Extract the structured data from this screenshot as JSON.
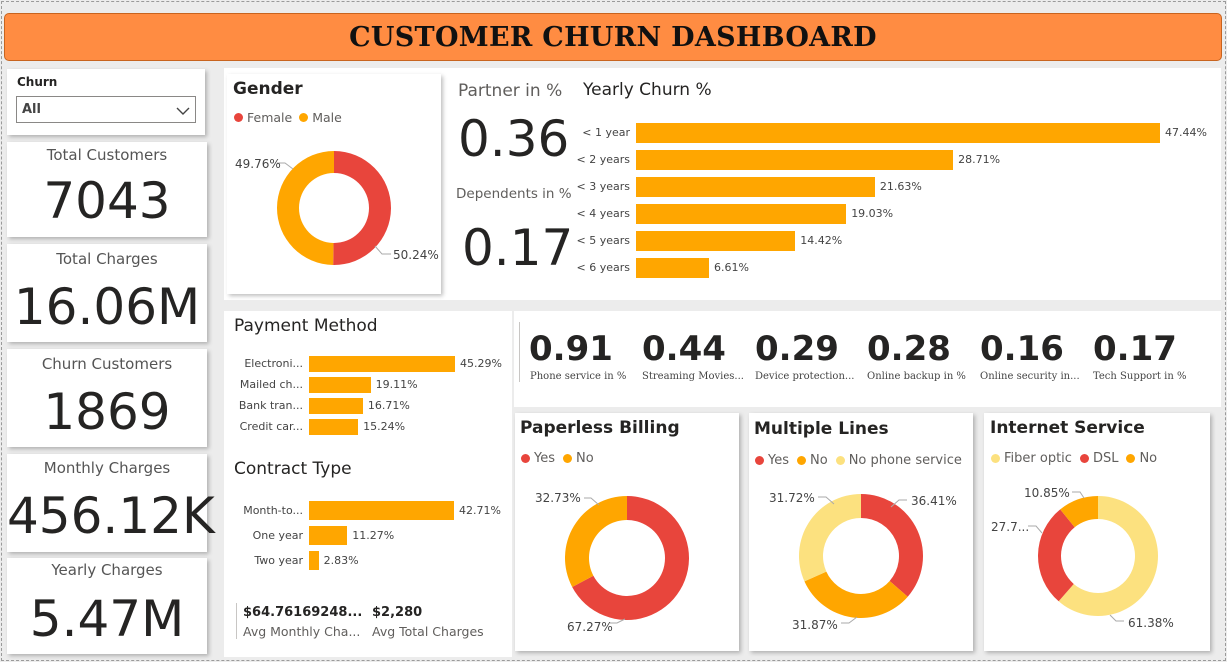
{
  "title": "CUSTOMER CHURN DASHBOARD",
  "slicer": {
    "label": "Churn",
    "value": "All"
  },
  "kpis": {
    "total_customers": {
      "label": "Total Customers",
      "value": "7043"
    },
    "total_charges": {
      "label": "Total Charges",
      "value": "16.06M"
    },
    "churn_customers": {
      "label": "Churn Customers",
      "value": "1869"
    },
    "monthly_charges": {
      "label": "Monthly Charges",
      "value": "456.12K"
    },
    "yearly_charges": {
      "label": "Yearly Charges",
      "value": "5.47M"
    }
  },
  "gender": {
    "title": "Gender",
    "legend": [
      "Female",
      "Male"
    ],
    "labels": {
      "male": "49.76%",
      "female": "50.24%"
    }
  },
  "partner": {
    "label": "Partner in %",
    "value": "0.36"
  },
  "dependents": {
    "label": "Dependents in %",
    "value": "0.17"
  },
  "yearly_churn": {
    "title": "Yearly Churn %"
  },
  "payment": {
    "title": "Payment Method"
  },
  "contract": {
    "title": "Contract Type"
  },
  "avg": {
    "monthly": {
      "value": "$64.76169248...",
      "label": "Avg Monthly Cha..."
    },
    "total": {
      "value": "$2,280",
      "label": "Avg Total Charges"
    }
  },
  "services": [
    {
      "value": "0.91",
      "label": "Phone service in %"
    },
    {
      "value": "0.44",
      "label": "Streaming Movies..."
    },
    {
      "value": "0.29",
      "label": "Device protection..."
    },
    {
      "value": "0.28",
      "label": "Online backup in %"
    },
    {
      "value": "0.16",
      "label": "Online security in..."
    },
    {
      "value": "0.17",
      "label": "Tech Support in %"
    }
  ],
  "paperless": {
    "title": "Paperless Billing",
    "legend": [
      "Yes",
      "No"
    ],
    "labels": {
      "no": "32.73%",
      "yes": "67.27%"
    }
  },
  "multiple_lines": {
    "title": "Multiple Lines",
    "legend": [
      "Yes",
      "No",
      "No phone service"
    ],
    "labels": {
      "nps": "31.72%",
      "yes": "36.41%",
      "no": "31.87%"
    }
  },
  "internet": {
    "title": "Internet Service",
    "legend": [
      "Fiber optic",
      "DSL",
      "No"
    ],
    "labels": {
      "no": "10.85%",
      "dsl": "27.7...",
      "fiber": "61.38%"
    }
  },
  "colors": {
    "red": "#e8453c",
    "orange": "#ffa600",
    "yellow": "#fce17f",
    "title_bg": "#ff8c42"
  },
  "chart_data": [
    {
      "type": "bar",
      "title": "Yearly Churn %",
      "categories": [
        "< 1 year",
        "< 2 years",
        "< 3 years",
        "< 4 years",
        "< 5 years",
        "< 6 years"
      ],
      "values": [
        47.44,
        28.71,
        21.63,
        19.03,
        14.42,
        6.61
      ],
      "value_labels": [
        "47.44%",
        "28.71%",
        "21.63%",
        "19.03%",
        "14.42%",
        "6.61%"
      ],
      "orientation": "horizontal",
      "grid": false
    },
    {
      "type": "bar",
      "title": "Payment Method",
      "categories": [
        "Electroni...",
        "Mailed ch...",
        "Bank tran...",
        "Credit car..."
      ],
      "values": [
        45.29,
        19.11,
        16.71,
        15.24
      ],
      "value_labels": [
        "45.29%",
        "19.11%",
        "16.71%",
        "15.24%"
      ],
      "orientation": "horizontal",
      "grid": false
    },
    {
      "type": "bar",
      "title": "Contract Type",
      "categories": [
        "Month-to...",
        "One year",
        "Two year"
      ],
      "values": [
        42.71,
        11.27,
        2.83
      ],
      "value_labels": [
        "42.71%",
        "11.27%",
        "2.83%"
      ],
      "orientation": "horizontal",
      "grid": false
    },
    {
      "type": "pie",
      "title": "Gender",
      "categories": [
        "Female",
        "Male"
      ],
      "values": [
        50.24,
        49.76
      ]
    },
    {
      "type": "pie",
      "title": "Paperless Billing",
      "categories": [
        "Yes",
        "No"
      ],
      "values": [
        67.27,
        32.73
      ]
    },
    {
      "type": "pie",
      "title": "Multiple Lines",
      "categories": [
        "Yes",
        "No",
        "No phone service"
      ],
      "values": [
        36.41,
        31.87,
        31.72
      ]
    },
    {
      "type": "pie",
      "title": "Internet Service",
      "categories": [
        "Fiber optic",
        "DSL",
        "No"
      ],
      "values": [
        61.38,
        27.77,
        10.85
      ]
    }
  ]
}
